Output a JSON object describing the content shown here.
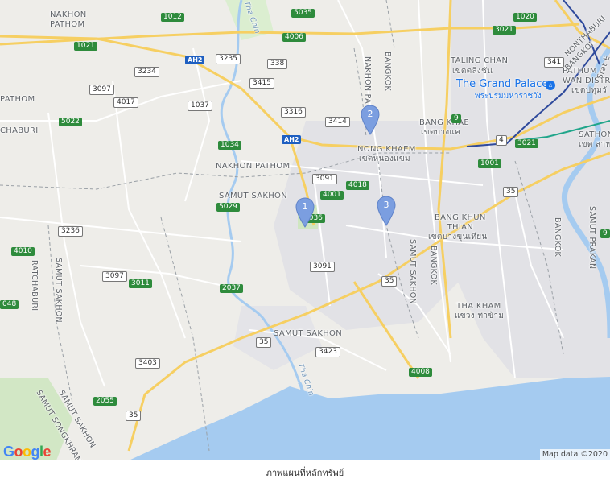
{
  "map": {
    "places": [
      {
        "id": "nakhon-pathom-top",
        "text": "NAKHON\nPATHOM"
      },
      {
        "id": "pathom-left",
        "text": "PATHOM"
      },
      {
        "id": "chaburi-left",
        "text": "CHABURI"
      },
      {
        "id": "taling-chan",
        "text": "TALING CHAN"
      },
      {
        "id": "taling-chan-th",
        "text": "เขตตลิ่งชัน"
      },
      {
        "id": "nakhon-pathom-mid",
        "text": "NAKHON PATHOM"
      },
      {
        "id": "samut-sakhon-mid",
        "text": "SAMUT SAKHON"
      },
      {
        "id": "nong-khaem",
        "text": "NONG KHAEM"
      },
      {
        "id": "nong-khaem-th",
        "text": "เขตหนองแขม"
      },
      {
        "id": "bang-khae",
        "text": "BANG KHAE"
      },
      {
        "id": "bang-khae-th",
        "text": "เขตบางแค"
      },
      {
        "id": "bang-khun-thian",
        "text": "BANG KHUN\nTHIAN"
      },
      {
        "id": "bang-khun-thian-th",
        "text": "เขตบางขุนเทียน"
      },
      {
        "id": "nakhon-pa",
        "text": "NAKHON PA"
      },
      {
        "id": "bangkok-v",
        "text": "BANGKOK"
      },
      {
        "id": "samut-sakhon-v",
        "text": "SAMUT SAKHON"
      },
      {
        "id": "bangkok-v2",
        "text": "BANGKOK"
      },
      {
        "id": "bangkok-v3",
        "text": "BANGKOK"
      },
      {
        "id": "samut-prakan-v",
        "text": "SAMUT PRAKAN"
      },
      {
        "id": "ratchaburi-v",
        "text": "RATCHABURI"
      },
      {
        "id": "samut-sakhon-v2",
        "text": "SAMUT SAKHON"
      },
      {
        "id": "samut-songkhram-v",
        "text": "SAMUT SONGKHRAM"
      },
      {
        "id": "samut-sakhon-v3",
        "text": "SAMUT SAKHON"
      },
      {
        "id": "tha-kham",
        "text": "THA KHAM"
      },
      {
        "id": "tha-kham-th",
        "text": "แขวง ท่าข้าม"
      },
      {
        "id": "samut-sakhon-bottom",
        "text": "SAMUT SAKHON"
      },
      {
        "id": "pathum-wan",
        "text": "PATHUM\nWAN DISTR"
      },
      {
        "id": "pathum-wan-th",
        "text": "เขตปทุมวั"
      },
      {
        "id": "sathon",
        "text": "SATHON"
      },
      {
        "id": "sathon-th",
        "text": "เขต สาท"
      },
      {
        "id": "nonthaburi",
        "text": "NONTHABURI"
      },
      {
        "id": "bangkok-ne",
        "text": "BANGKOK"
      },
      {
        "id": "srat",
        "text": "Srat E"
      },
      {
        "id": "tha-chin-top",
        "text": "Tha Chin"
      },
      {
        "id": "tha-chin-bottom",
        "text": "Tha Chin"
      }
    ],
    "landmark": {
      "name": "The Grand Palace",
      "name_th": "พระบรมมหาราชวัง"
    },
    "shields": [
      {
        "id": "1012",
        "text": "1012",
        "kind": "g"
      },
      {
        "id": "5035",
        "text": "5035",
        "kind": "g"
      },
      {
        "id": "1020",
        "text": "1020",
        "kind": "g"
      },
      {
        "id": "1021",
        "text": "1021",
        "kind": "g"
      },
      {
        "id": "4006",
        "text": "4006",
        "kind": "g"
      },
      {
        "id": "3021a",
        "text": "3021",
        "kind": "g"
      },
      {
        "id": "ah2a",
        "text": "AH2",
        "kind": "ah"
      },
      {
        "id": "3235",
        "text": "3235",
        "kind": "w"
      },
      {
        "id": "338",
        "text": "338",
        "kind": "w"
      },
      {
        "id": "3234",
        "text": "3234",
        "kind": "w"
      },
      {
        "id": "3415",
        "text": "3415",
        "kind": "w"
      },
      {
        "id": "341",
        "text": "341",
        "kind": "w"
      },
      {
        "id": "3097a",
        "text": "3097",
        "kind": "w"
      },
      {
        "id": "4017",
        "text": "4017",
        "kind": "w"
      },
      {
        "id": "1037",
        "text": "1037",
        "kind": "w"
      },
      {
        "id": "3316",
        "text": "3316",
        "kind": "w"
      },
      {
        "id": "5022",
        "text": "5022",
        "kind": "g"
      },
      {
        "id": "3414",
        "text": "3414",
        "kind": "w"
      },
      {
        "id": "9",
        "text": "9",
        "kind": "g"
      },
      {
        "id": "ah2b",
        "text": "AH2",
        "kind": "ah"
      },
      {
        "id": "4",
        "text": "4",
        "kind": "w"
      },
      {
        "id": "3021b",
        "text": "3021",
        "kind": "g"
      },
      {
        "id": "1034",
        "text": "1034",
        "kind": "g"
      },
      {
        "id": "1001",
        "text": "1001",
        "kind": "g"
      },
      {
        "id": "3091a",
        "text": "3091",
        "kind": "w"
      },
      {
        "id": "4018",
        "text": "4018",
        "kind": "g"
      },
      {
        "id": "4001",
        "text": "4001",
        "kind": "g"
      },
      {
        "id": "35a",
        "text": "35",
        "kind": "w"
      },
      {
        "id": "5029",
        "text": "5029",
        "kind": "g"
      },
      {
        "id": "5036",
        "text": "5036",
        "kind": "g"
      },
      {
        "id": "3236",
        "text": "3236",
        "kind": "w"
      },
      {
        "id": "4010",
        "text": "4010",
        "kind": "g"
      },
      {
        "id": "3091b",
        "text": "3091",
        "kind": "w"
      },
      {
        "id": "3097b",
        "text": "3097",
        "kind": "w"
      },
      {
        "id": "3011",
        "text": "3011",
        "kind": "g"
      },
      {
        "id": "35b",
        "text": "35",
        "kind": "w"
      },
      {
        "id": "2037",
        "text": "2037",
        "kind": "g"
      },
      {
        "id": "048",
        "text": "048",
        "kind": "g"
      },
      {
        "id": "35c",
        "text": "35",
        "kind": "w"
      },
      {
        "id": "3423",
        "text": "3423",
        "kind": "w"
      },
      {
        "id": "3403",
        "text": "3403",
        "kind": "w"
      },
      {
        "id": "4008",
        "text": "4008",
        "kind": "g"
      },
      {
        "id": "2055",
        "text": "2055",
        "kind": "g"
      },
      {
        "id": "35d",
        "text": "35",
        "kind": "w"
      },
      {
        "id": "9b",
        "text": "9",
        "kind": "g"
      }
    ],
    "markers": [
      {
        "id": "1",
        "label": "1"
      },
      {
        "id": "2",
        "label": "2"
      },
      {
        "id": "3",
        "label": "3"
      }
    ],
    "attribution": "Map data ©2020",
    "logo": "Google",
    "colors": {
      "land": "#eeede9",
      "water": "#a5cbf0",
      "park": "#cde5c0",
      "urban": "#e1e1e6",
      "road_major": "#f6cf62",
      "road_minor": "#ffffff",
      "marker": "#7b9ee0",
      "bts_blue": "#2f4a9c",
      "bts_green": "#1fa58a"
    }
  },
  "caption": "ภาพแผนที่หลักทรัพย์"
}
